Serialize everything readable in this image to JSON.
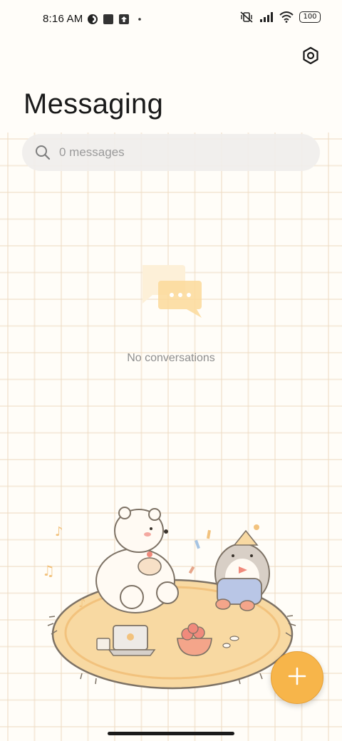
{
  "status_bar": {
    "time": "8:16 AM",
    "battery": "100",
    "left_icons": [
      "data-saver-icon",
      "square-notification-icon",
      "upload-notification-icon",
      "dot-icon"
    ],
    "right_icons": [
      "vibrate-off-icon",
      "signal-icon",
      "wifi-icon",
      "battery-icon"
    ]
  },
  "header": {
    "title": "Messaging",
    "settings_icon": "settings-icon"
  },
  "search": {
    "placeholder": "0 messages",
    "icon": "search-icon"
  },
  "empty_state": {
    "icon": "chat-bubbles-icon",
    "text": "No conversations"
  },
  "fab": {
    "icon": "plus-icon",
    "color": "#f7b54a"
  },
  "colors": {
    "grid_line": "#eedcc4",
    "accent": "#f7b54a",
    "rug": "#f8d9a2"
  }
}
